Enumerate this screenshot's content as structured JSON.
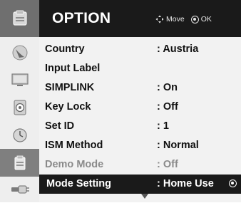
{
  "menu": {
    "title": "OPTION",
    "hint_move": "Move",
    "hint_ok": "OK"
  },
  "sidebar": {
    "tabs": [
      {
        "icon": "option-icon"
      },
      {
        "icon": "satellite-dish-icon"
      },
      {
        "icon": "picture-icon"
      },
      {
        "icon": "audio-icon"
      },
      {
        "icon": "time-icon"
      },
      {
        "icon": "option-icon",
        "active": true
      },
      {
        "icon": "input-icon"
      }
    ]
  },
  "rows": [
    {
      "label": "Country",
      "value": ": Austria"
    },
    {
      "label": "Input Label",
      "value": ""
    },
    {
      "label": "SIMPLINK",
      "value": ": On"
    },
    {
      "label": "Key Lock",
      "value": ": Off"
    },
    {
      "label": "Set ID",
      "value": ": 1"
    },
    {
      "label": "ISM Method",
      "value": ": Normal"
    },
    {
      "label": "Demo Mode",
      "value": ": Off",
      "disabled": true
    },
    {
      "label": "Mode Setting",
      "value": ": Home Use",
      "selected": true
    }
  ]
}
